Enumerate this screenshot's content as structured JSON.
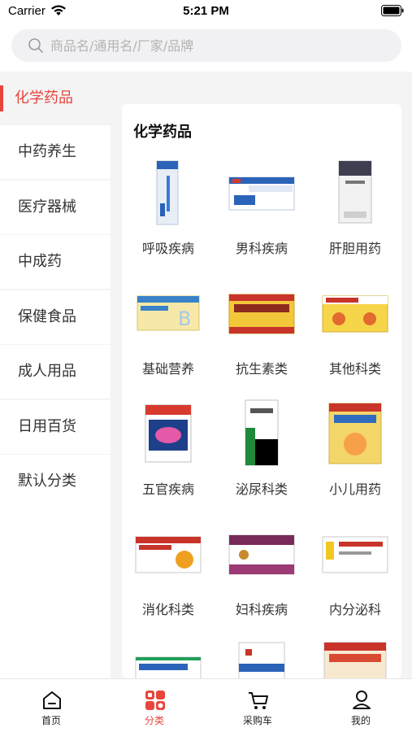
{
  "status_bar": {
    "carrier": "Carrier",
    "time": "5:21 PM"
  },
  "search": {
    "placeholder": "商品名/通用名/厂家/品牌"
  },
  "sidebar": {
    "items": [
      {
        "label": "化学药品",
        "active": true
      },
      {
        "label": "中药养生"
      },
      {
        "label": "医疗器械"
      },
      {
        "label": "中成药"
      },
      {
        "label": "保健食品"
      },
      {
        "label": "成人用品"
      },
      {
        "label": "日用百货"
      },
      {
        "label": "默认分类"
      }
    ]
  },
  "panel": {
    "title": "化学药品",
    "categories": [
      {
        "label": "呼吸疾病",
        "icon": "medicine-box-blue"
      },
      {
        "label": "男科疾病",
        "icon": "medicine-box-blue-white"
      },
      {
        "label": "肝胆用药",
        "icon": "medicine-box-gray"
      },
      {
        "label": "基础营养",
        "icon": "medicine-box-yellow-blue"
      },
      {
        "label": "抗生素类",
        "icon": "medicine-box-yellow"
      },
      {
        "label": "其他科类",
        "icon": "medicine-box-yellow-red"
      },
      {
        "label": "五官疾病",
        "icon": "medicine-box-blue-pink"
      },
      {
        "label": "泌尿科类",
        "icon": "medicine-box-green"
      },
      {
        "label": "小儿用药",
        "icon": "medicine-box-kids"
      },
      {
        "label": "消化科类",
        "icon": "medicine-box-orange"
      },
      {
        "label": "妇科疾病",
        "icon": "medicine-box-purple"
      },
      {
        "label": "内分泌科",
        "icon": "medicine-box-white-yellow"
      },
      {
        "label": "",
        "icon": "medicine-box-white"
      },
      {
        "label": "",
        "icon": "medicine-box-white-red"
      },
      {
        "label": "",
        "icon": "medicine-box-red"
      }
    ]
  },
  "tab_bar": {
    "tabs": [
      {
        "label": "首页",
        "icon": "home-icon"
      },
      {
        "label": "分类",
        "icon": "category-icon",
        "active": true
      },
      {
        "label": "采购车",
        "icon": "cart-icon"
      },
      {
        "label": "我的",
        "icon": "user-icon"
      }
    ]
  },
  "colors": {
    "accent": "#e8453c",
    "background": "#f4f4f4"
  }
}
